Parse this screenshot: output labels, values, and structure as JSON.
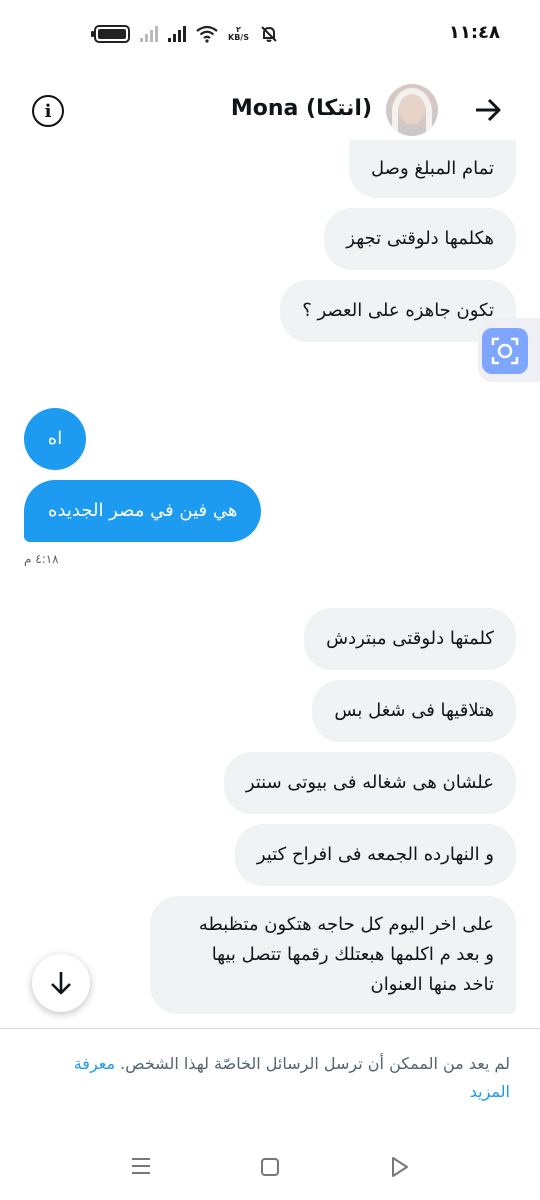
{
  "status_bar": {
    "time": "١١:٤٨",
    "net_speed_value": "٢",
    "net_speed_unit": "KB/S"
  },
  "header": {
    "contact_name": "Mona (انتكا)",
    "info_icon": "info-circle-icon",
    "back_icon": "arrow-right-icon"
  },
  "messages": [
    {
      "text": "تمام المبلغ وصل",
      "dir": "in"
    },
    {
      "text": "هكلمها دلوقتى تجهز",
      "dir": "in"
    },
    {
      "text": "تكون جاهزه على العصر ؟",
      "dir": "in"
    },
    {
      "text": "اه",
      "dir": "out"
    },
    {
      "text": "هي فين في مصر الجديده",
      "dir": "out"
    },
    {
      "text": "كلمتها دلوقتى مبتردش",
      "dir": "in"
    },
    {
      "text": "هتلاقيها فى شغل بس",
      "dir": "in"
    },
    {
      "text": "علشان هى شغاله فى بيوتى سنتر",
      "dir": "in"
    },
    {
      "text": "و النهارده الجمعه فى افراح كتير",
      "dir": "in"
    },
    {
      "text_lines": [
        "على اخر اليوم كل حاجه هتكون متظبطه",
        "و بعد م اكلمها هبعتلك رقمها تتصل بيها",
        "تاخد منها العنوان"
      ],
      "dir": "in"
    }
  ],
  "timestamps": {
    "outgoing": "٤:١٨ م",
    "partial_incoming": "م"
  },
  "footer": {
    "notice_text": "لم يعد من الممكن أن ترسل الرسائل الخاصّة لهذا الشخص.",
    "learn_more": "معرفة المزيد"
  },
  "colors": {
    "accent": "#1d9bf0",
    "incoming_bubble": "#eff3f4",
    "scan_button": "#7ea6ff"
  }
}
